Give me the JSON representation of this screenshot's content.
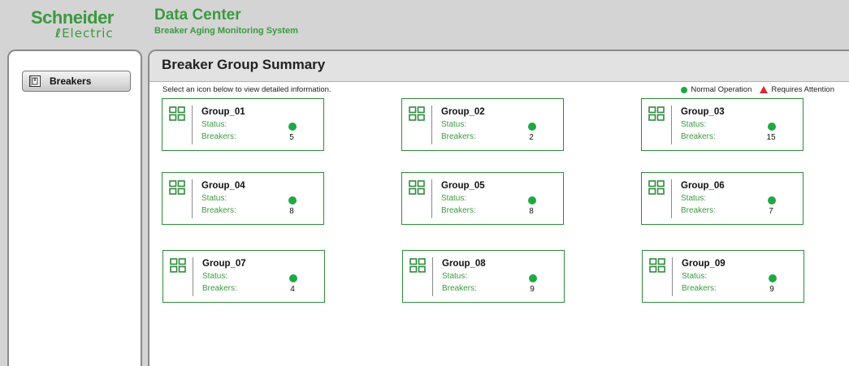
{
  "brand": {
    "name_top": "Schneider",
    "name_bottom": "Electric",
    "color": "#3a9a3f"
  },
  "app": {
    "title": "Data Center",
    "subtitle": "Breaker Aging Monitoring System"
  },
  "sidebar": {
    "items": [
      {
        "label": "Breakers",
        "icon": "breaker-icon"
      }
    ]
  },
  "main": {
    "title": "Breaker Group Summary",
    "instruction": "Select an icon below to view detailed information.",
    "legend": {
      "normal": "Normal Operation",
      "attention": "Requires Attention",
      "normal_color": "#1fa844",
      "attention_color": "#d62a2a"
    },
    "status_label": "Status:",
    "breakers_label": "Breakers:",
    "groups": [
      {
        "name": "Group_01",
        "status": "normal",
        "breakers": "5"
      },
      {
        "name": "Group_02",
        "status": "normal",
        "breakers": "2"
      },
      {
        "name": "Group_03",
        "status": "normal",
        "breakers": "15"
      },
      {
        "name": "Group_04",
        "status": "normal",
        "breakers": "8"
      },
      {
        "name": "Group_05",
        "status": "normal",
        "breakers": "8"
      },
      {
        "name": "Group_06",
        "status": "normal",
        "breakers": "7"
      },
      {
        "name": "Group_07",
        "status": "normal",
        "breakers": "4"
      },
      {
        "name": "Group_08",
        "status": "normal",
        "breakers": "9"
      },
      {
        "name": "Group_09",
        "status": "normal",
        "breakers": "9"
      }
    ]
  }
}
